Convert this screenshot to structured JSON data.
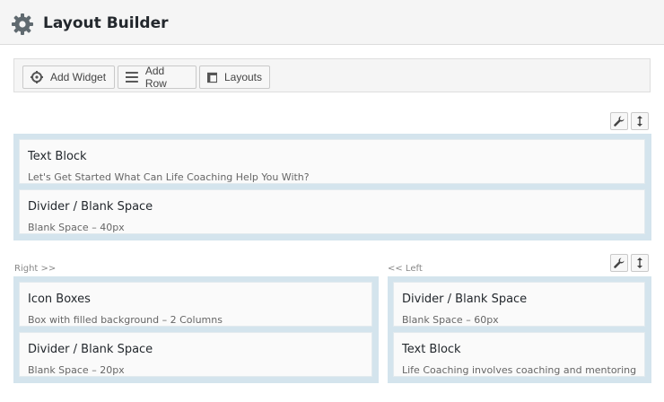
{
  "header": {
    "title": "Layout Builder",
    "icon": "gear-icon"
  },
  "toolbar": {
    "add_widget": "Add Widget",
    "add_row": "Add Row",
    "layouts": "Layouts"
  },
  "row1": {
    "widgets": [
      {
        "title": "Text Block",
        "desc": "Let's Get Started What Can Life Coaching Help You With?"
      },
      {
        "title": "Divider / Blank Space",
        "desc": "Blank Space  –  40px"
      }
    ]
  },
  "row2": {
    "left_label": "Right >>",
    "right_label": "<< Left",
    "left_widgets": [
      {
        "title": "Icon Boxes",
        "desc": "Box with filled background  –  2 Columns"
      },
      {
        "title": "Divider / Blank Space",
        "desc": "Blank Space  –  20px"
      }
    ],
    "right_widgets": [
      {
        "title": "Divider / Blank Space",
        "desc": "Blank Space  –  60px"
      },
      {
        "title": "Text Block",
        "desc": "Life Coaching involves coaching and mentoring"
      }
    ]
  },
  "colors": {
    "frame": "#d4e4ed",
    "widget_bg": "#fafafa"
  }
}
